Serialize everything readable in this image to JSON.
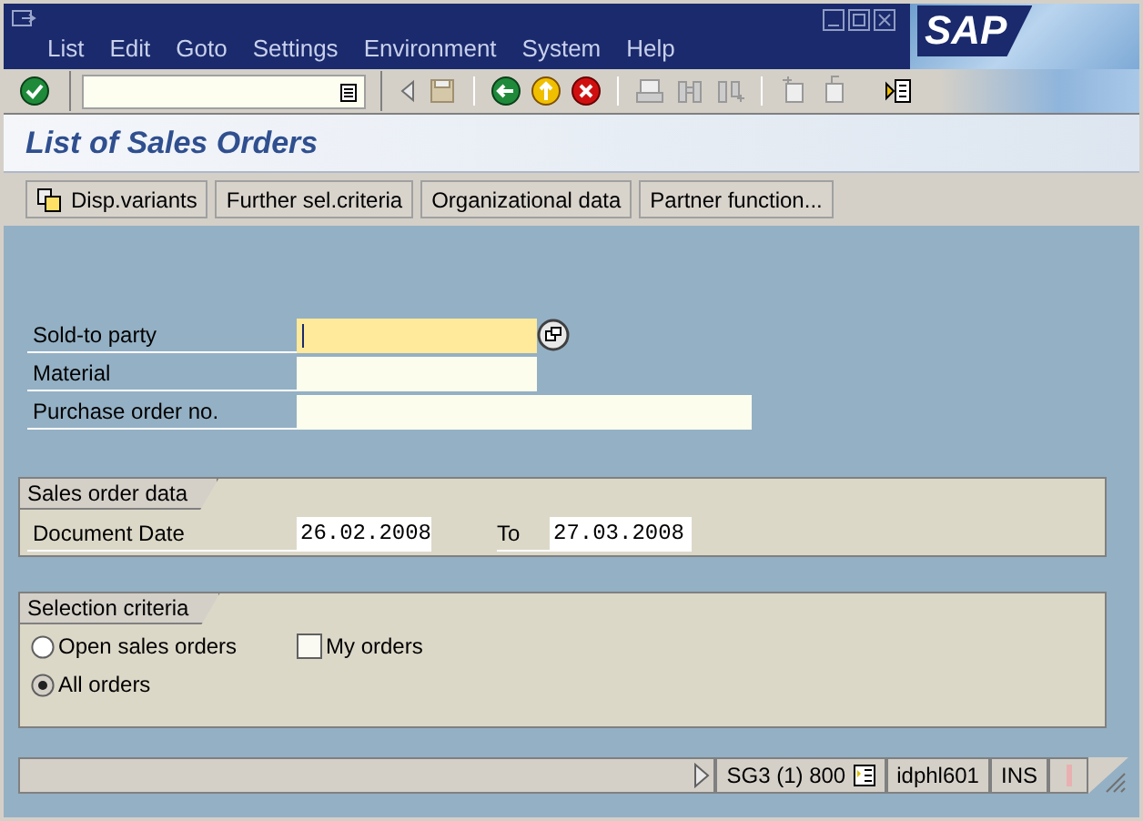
{
  "menu": [
    "List",
    "Edit",
    "Goto",
    "Settings",
    "Environment",
    "System",
    "Help"
  ],
  "logo": "SAP",
  "title": "List of Sales Orders",
  "buttons": [
    {
      "label": "Disp.variants",
      "icon": true
    },
    {
      "label": "Further sel.criteria",
      "icon": false
    },
    {
      "label": "Organizational data",
      "icon": false
    },
    {
      "label": "Partner function...",
      "icon": false
    }
  ],
  "fields": [
    {
      "label": "Sold-to party",
      "focused": true,
      "matchcode": true,
      "kind": "short"
    },
    {
      "label": "Material",
      "focused": false,
      "matchcode": false,
      "kind": "short"
    },
    {
      "label": "Purchase order no.",
      "focused": false,
      "matchcode": false,
      "kind": "long"
    }
  ],
  "sales_order_data": {
    "title": "Sales order data",
    "label": "Document Date",
    "from": "26.02.2008",
    "to_label": "To",
    "to": "27.03.2008"
  },
  "selection": {
    "title": "Selection criteria",
    "options": [
      {
        "kind": "radio",
        "label": "Open sales orders",
        "selected": false
      },
      {
        "kind": "checkbox",
        "label": "My orders",
        "checked": false
      },
      {
        "kind": "radio",
        "label": "All orders",
        "selected": true
      }
    ]
  },
  "status_bar": {
    "system": "SG3 (1) 800",
    "server": "idphl601",
    "mode": "INS"
  }
}
